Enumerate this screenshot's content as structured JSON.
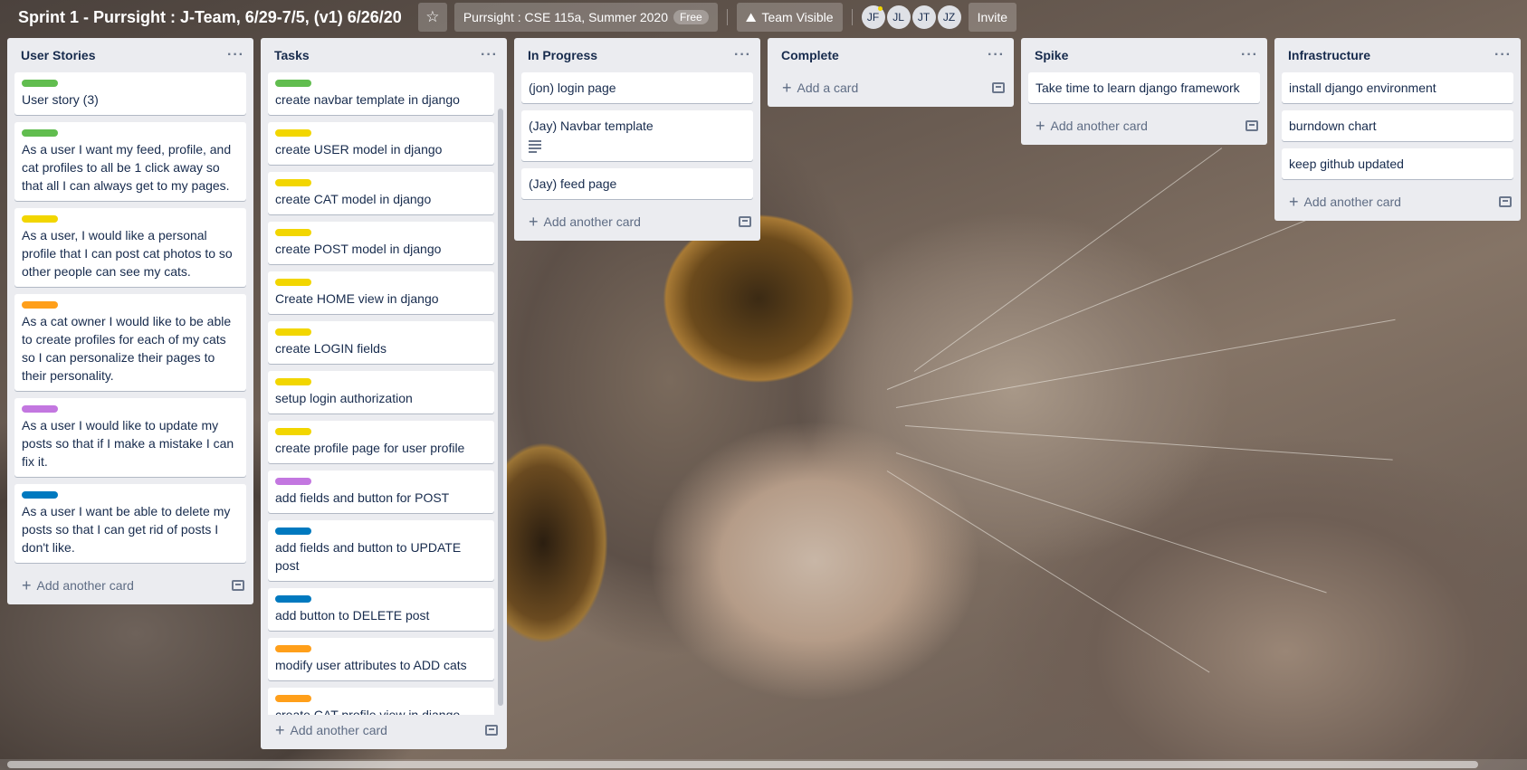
{
  "header": {
    "title": "Sprint 1 - Purrsight : J-Team, 6/29-7/5, (v1) 6/26/20",
    "team_name": "Purrsight : CSE 115a, Summer 2020",
    "team_badge": "Free",
    "visibility": "Team Visible",
    "members": [
      "JF",
      "JL",
      "JT",
      "JZ"
    ],
    "invite": "Invite",
    "star_icon": "star-icon",
    "visibility_icon": "team-icon"
  },
  "lists": {
    "user_stories": {
      "title": "User Stories",
      "add_label": "Add another card",
      "cards": [
        {
          "text": "User story (3)",
          "label": "green"
        },
        {
          "text": "As a user I want my feed, profile, and cat profiles to all be 1 click away so that all I can always get to my pages.",
          "label": "green"
        },
        {
          "text": "As a user, I would like a personal profile that I can post cat photos to so other people can see my cats.",
          "label": "yellow"
        },
        {
          "text": "As a cat owner I would like to be able to create profiles for each of my cats so I can personalize their pages to their personality.",
          "label": "orange"
        },
        {
          "text": "As a user I would like to update my posts so that if I make a mistake I can fix it.",
          "label": "purple"
        },
        {
          "text": "As a user I want be able to delete my posts so that I can get rid of posts I don't like.",
          "label": "blue"
        }
      ]
    },
    "tasks": {
      "title": "Tasks",
      "add_label": "Add another card",
      "cards": [
        {
          "text": "create navbar template in django",
          "label": "green"
        },
        {
          "text": "create USER model in django",
          "label": "yellow"
        },
        {
          "text": "create CAT model in django",
          "label": "yellow"
        },
        {
          "text": "create POST model in django",
          "label": "yellow"
        },
        {
          "text": "Create HOME view in django",
          "label": "yellow"
        },
        {
          "text": "create LOGIN fields",
          "label": "yellow"
        },
        {
          "text": "setup login authorization",
          "label": "yellow"
        },
        {
          "text": "create profile page for user profile",
          "label": "yellow"
        },
        {
          "text": "add fields and button for POST",
          "label": "purple"
        },
        {
          "text": "add fields and button to UPDATE post",
          "label": "blue"
        },
        {
          "text": "add button to DELETE post",
          "label": "blue"
        },
        {
          "text": "modify user attributes to ADD cats",
          "label": "orange"
        },
        {
          "text": "create CAT profile view in django",
          "label": "orange"
        },
        {
          "text": "",
          "label": "blue"
        }
      ]
    },
    "in_progress": {
      "title": "In Progress",
      "add_label": "Add another card",
      "cards": [
        {
          "text": "(jon) login page"
        },
        {
          "text": "(Jay) Navbar template",
          "has_description": true
        },
        {
          "text": "(Jay) feed page"
        }
      ]
    },
    "complete": {
      "title": "Complete",
      "add_label": "Add a card",
      "cards": []
    },
    "spike": {
      "title": "Spike",
      "add_label": "Add another card",
      "cards": [
        {
          "text": "Take time to learn django framework"
        }
      ]
    },
    "infrastructure": {
      "title": "Infrastructure",
      "add_label": "Add another card",
      "cards": [
        {
          "text": "install django environment"
        },
        {
          "text": "burndown chart"
        },
        {
          "text": "keep github updated"
        }
      ]
    }
  },
  "colors": {
    "green": "#61bd4f",
    "yellow": "#f2d600",
    "orange": "#ff9f1a",
    "purple": "#c377e0",
    "blue": "#0079bf",
    "list_bg": "#ebecf0",
    "text": "#172b4d"
  }
}
